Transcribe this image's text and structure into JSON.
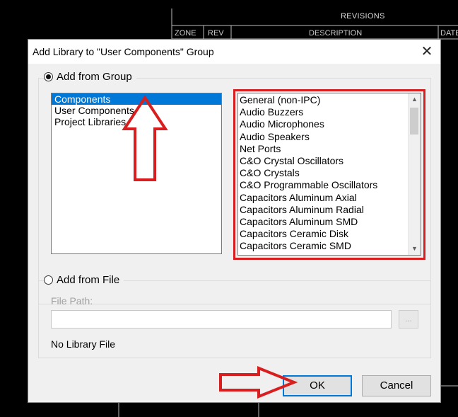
{
  "background": {
    "revisions_title": "REVISIONS",
    "columns": [
      "ZONE",
      "REV",
      "DESCRIPTION",
      "DATE"
    ]
  },
  "dialog": {
    "title": "Add Library to \"User Components\" Group",
    "close_icon": "close-icon",
    "add_from_group": {
      "label": "Add from Group",
      "selected": true,
      "groups": [
        "Components",
        "User Components",
        "Project Libraries"
      ],
      "selected_group": "Components",
      "libraries": [
        "General (non-IPC)",
        "Audio Buzzers",
        "Audio Microphones",
        "Audio Speakers",
        "Net Ports",
        "C&O Crystal Oscillators",
        "C&O Crystals",
        "C&O Programmable Oscillators",
        "Capacitors Aluminum Axial",
        "Capacitors Aluminum Radial",
        "Capacitors Aluminum SMD",
        "Capacitors Ceramic Disk",
        "Capacitors Ceramic SMD"
      ]
    },
    "add_from_file": {
      "label": "Add from File",
      "selected": false,
      "file_path_label": "File Path:",
      "file_path_value": "",
      "browse_label": "...",
      "status": "No Library File"
    },
    "buttons": {
      "ok": "OK",
      "cancel": "Cancel"
    }
  },
  "annotations": {
    "color": "#d81e1e",
    "icons": [
      "up-arrow-annotation",
      "right-arrow-annotation",
      "highlight-box"
    ]
  }
}
